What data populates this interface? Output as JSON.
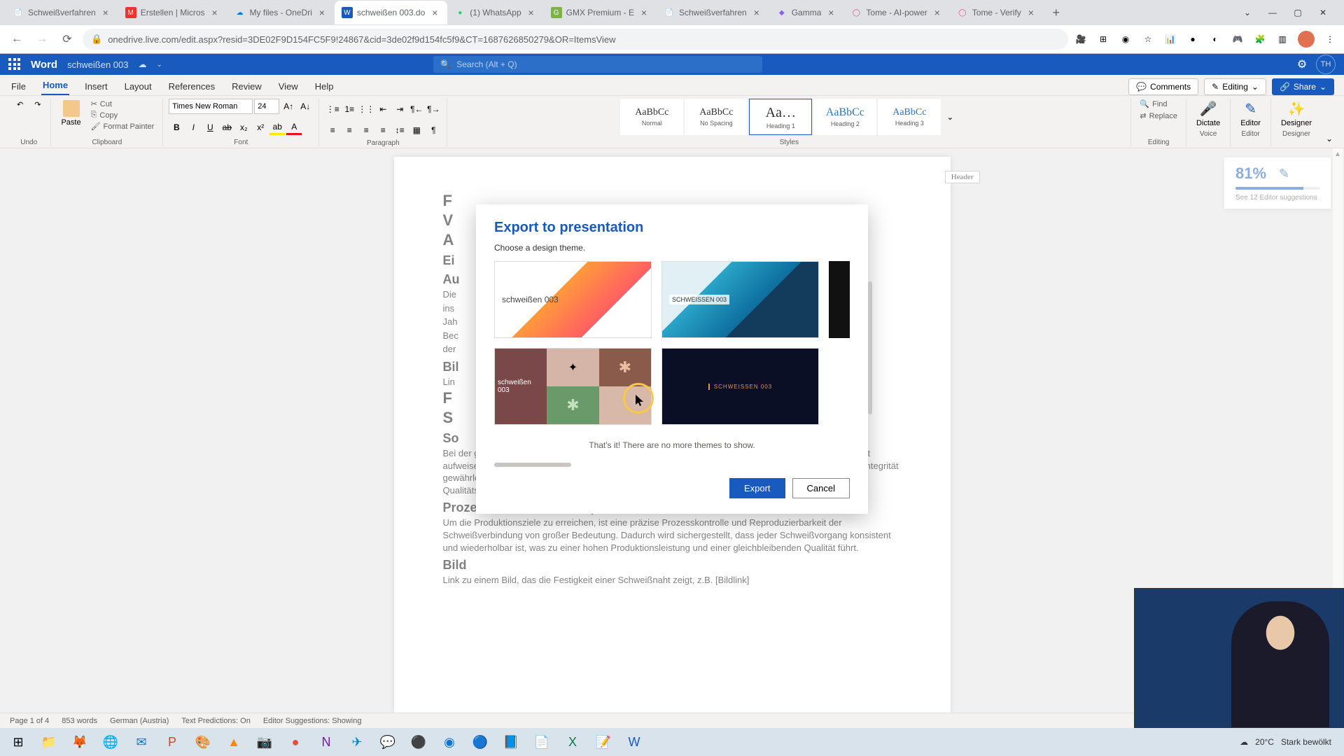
{
  "browser": {
    "tabs": [
      {
        "title": "Schweißverfahren",
        "favicon": "📄"
      },
      {
        "title": "Erstellen | Micros",
        "favicon": "Ⓜ"
      },
      {
        "title": "My files - OneDri",
        "favicon": "☁"
      },
      {
        "title": "schweißen 003.do",
        "favicon": "W",
        "active": true
      },
      {
        "title": "(1) WhatsApp",
        "favicon": "💬"
      },
      {
        "title": "GMX Premium - E",
        "favicon": "✉"
      },
      {
        "title": "Schweißverfahren",
        "favicon": "📄"
      },
      {
        "title": "Gamma",
        "favicon": "G"
      },
      {
        "title": "Tome - AI-power",
        "favicon": "◯"
      },
      {
        "title": "Tome - Verify",
        "favicon": "◯"
      }
    ],
    "url": "onedrive.live.com/edit.aspx?resid=3DE02F9D154FC5F9!24867&cid=3de02f9d154fc5f9&CT=1687626850279&OR=ItemsView"
  },
  "word": {
    "app": "Word",
    "doc": "schweißen 003",
    "search_placeholder": "Search (Alt + Q)",
    "avatar": "TH",
    "tabs": [
      "File",
      "Home",
      "Insert",
      "Layout",
      "References",
      "Review",
      "View",
      "Help"
    ],
    "active_tab": "Home",
    "comments": "Comments",
    "editing": "Editing",
    "share": "Share",
    "font_name": "Times New Roman",
    "font_size": "24",
    "clipboard_cut": "Cut",
    "clipboard_copy": "Copy",
    "clipboard_fp": "Format Painter",
    "paste": "Paste",
    "undo": "Undo",
    "groups": {
      "clipboard": "Clipboard",
      "font": "Font",
      "paragraph": "Paragraph",
      "styles": "Styles",
      "editing": "Editing",
      "voice": "Voice",
      "editor": "Editor",
      "designer": "Designer"
    },
    "styles": [
      {
        "preview": "AaBbCc",
        "name": "Normal"
      },
      {
        "preview": "AaBbCc",
        "name": "No Spacing"
      },
      {
        "preview": "Aa…",
        "name": "Heading 1",
        "sel": true
      },
      {
        "preview": "AaBbCc",
        "name": "Heading 2"
      },
      {
        "preview": "AaBbCc",
        "name": "Heading 3"
      }
    ],
    "find": "Find",
    "replace": "Replace",
    "dictate": "Dictate",
    "editor": "Editor",
    "designer": "Designer",
    "header_tag": "Header"
  },
  "editor_panel": {
    "score": "81%",
    "suggestions": "See 12 Editor suggestions"
  },
  "doc": {
    "h_f": "F",
    "h_v": "V",
    "h_a": "A",
    "h_ei": "Ei",
    "h_au": "Au",
    "p_die": "Die",
    "p_ins": "ins",
    "p_jah": "Jah",
    "p_bec": "Bec",
    "p_der": "der",
    "h_bil": "Bil",
    "p_lin": "Lin",
    "h_f2": "F",
    "h_s": "S",
    "h_so": "So",
    "p1": "Bei der großen Serienproduktion ist es entscheidend, dass die Schweißverbindungen eine hohe Festigkeit aufweisen, um den Belastungen im Betrieb standzuhalten. Eine zuverlässige Verbindungsfestigkeit und -integrität gewährleisten die strukturelle Stabilität der Bauteile und minimieren das Risiko von Ausfällen oder Qualitätsproblemen.",
    "h_pk": "Prozesskontrolle und Reproduzierbarkeit",
    "p2": "Um die Produktionsziele zu erreichen, ist eine präzise Prozesskontrolle und Reproduzierbarkeit der Schweißverbindung von großer Bedeutung. Dadurch wird sichergestellt, dass jeder Schweißvorgang konsistent und wiederholbar ist, was zu einer hohen Produktionsleistung und einer gleichbleibenden Qualität führt.",
    "h_bild": "Bild",
    "p3": "Link zu einem Bild, das die Festigkeit einer Schweißnaht zeigt, z.B. [Bildlink]"
  },
  "modal": {
    "title": "Export to presentation",
    "sub": "Choose a design theme.",
    "theme1": "schweißen 003",
    "theme2": "SCHWEISSEN 003",
    "theme3": "schweißen 003",
    "theme4": "SCHWEISSEN 003",
    "empty": "That's it! There are no more themes to show.",
    "export": "Export",
    "cancel": "Cancel"
  },
  "status": {
    "page": "Page 1 of 4",
    "words": "853 words",
    "lang": "German (Austria)",
    "pred": "Text Predictions: On",
    "sugg": "Editor Suggestions: Showing"
  },
  "taskbar": {
    "weather_temp": "20°C",
    "weather_desc": "Stark bewölkt"
  }
}
